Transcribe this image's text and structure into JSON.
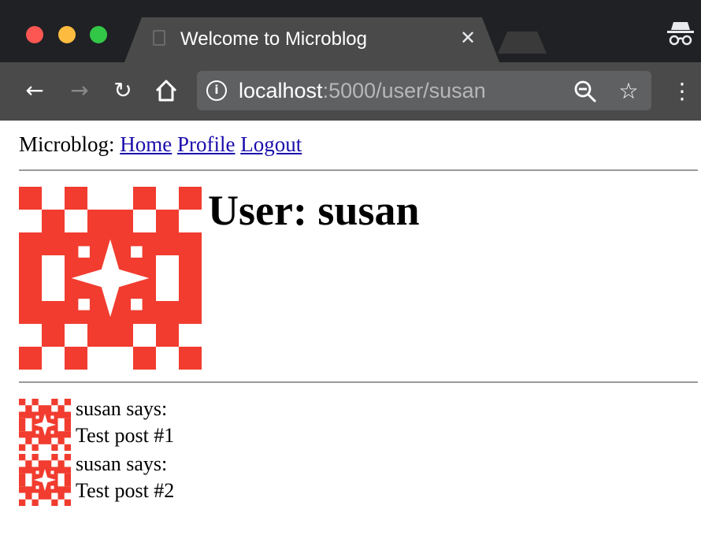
{
  "browser": {
    "tab_title": "Welcome to Microblog",
    "tab_close": "✕",
    "url_host": "localhost",
    "url_rest": ":5000/user/susan",
    "icons": [
      "back-icon",
      "forward-icon",
      "reload-icon",
      "home-icon",
      "info-icon",
      "zoom-out-icon",
      "bookmark-star-icon",
      "menu-icon",
      "incognito-icon"
    ],
    "accent": "#202124",
    "toolbar_color": "#4a4a4a"
  },
  "page": {
    "nav": {
      "brand": "Microblog:",
      "links": [
        "Home",
        "Profile",
        "Logout"
      ]
    },
    "heading": "User: susan",
    "avatar_color": "#f13c2f",
    "posts": [
      {
        "author": "susan says:",
        "body": "Test post #1"
      },
      {
        "author": "susan says:",
        "body": "Test post #2"
      }
    ]
  }
}
